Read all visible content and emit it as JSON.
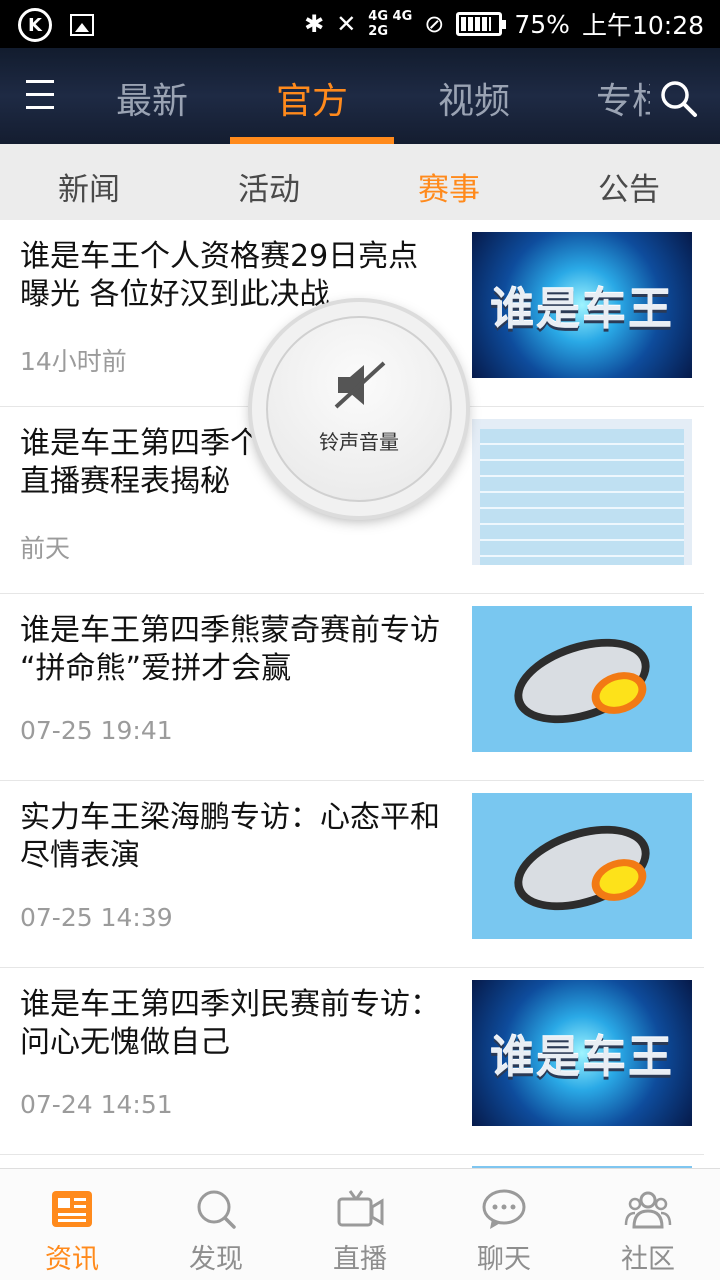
{
  "status_bar": {
    "battery": "75%",
    "time": "上午10:28",
    "net_top": "4G 4G",
    "net_bottom": "2G"
  },
  "top_nav": {
    "tabs": [
      "最新",
      "官方",
      "视频",
      "专栏"
    ],
    "active_index": 1
  },
  "sub_tabs": {
    "items": [
      "新闻",
      "活动",
      "赛事",
      "公告"
    ],
    "active_index": 2
  },
  "news": [
    {
      "title": "谁是车王个人资格赛29日亮点曝光 各位好汉到此决战",
      "time": "14小时前",
      "thumb": "谁是车王"
    },
    {
      "title": "谁是车王第四季个人赛即将开战 直播赛程表揭秘",
      "time": "前天",
      "thumb": ""
    },
    {
      "title": "谁是车王第四季熊蒙奇赛前专访 “拼命熊”爱拼才会赢",
      "time": "07-25 19:41",
      "thumb": ""
    },
    {
      "title": "实力车王梁海鹏专访：心态平和尽情表演",
      "time": "07-25 14:39",
      "thumb": ""
    },
    {
      "title": "谁是车王第四季刘民赛前专访：问心无愧做自己",
      "time": "07-24 14:51",
      "thumb": "谁是车王"
    }
  ],
  "volume_popup": {
    "label": "铃声音量",
    "icon": "speaker-muted-icon"
  },
  "bottom_nav": {
    "items": [
      {
        "label": "资讯",
        "icon": "news-icon"
      },
      {
        "label": "发现",
        "icon": "discover-icon"
      },
      {
        "label": "直播",
        "icon": "live-icon"
      },
      {
        "label": "聊天",
        "icon": "chat-icon"
      },
      {
        "label": "社区",
        "icon": "community-icon"
      }
    ],
    "active_index": 0
  },
  "colors": {
    "accent": "#ff8a1c",
    "nav_bg": "#1a2438",
    "inactive": "#8e8e8e"
  }
}
